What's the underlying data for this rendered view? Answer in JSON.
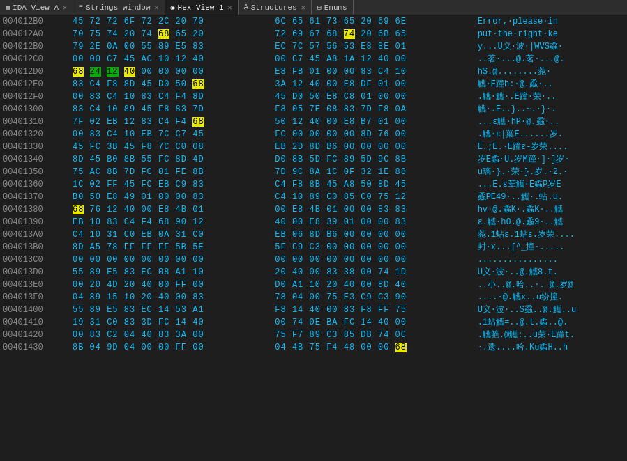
{
  "tabs": [
    {
      "id": "ida-view",
      "icon": "▦",
      "label": "IDA View-A",
      "active": false
    },
    {
      "id": "strings",
      "icon": "≡",
      "label": "Strings window",
      "active": false
    },
    {
      "id": "hex-view",
      "icon": "◉",
      "label": "Hex View-1",
      "active": true
    },
    {
      "id": "structures",
      "icon": "A",
      "label": "Structures",
      "active": false
    },
    {
      "id": "enums",
      "icon": "⊞",
      "label": "Enums",
      "active": false
    }
  ],
  "rows": [
    {
      "addr": "004012B0",
      "bytes1": [
        "45",
        "72",
        "72",
        "6F",
        "72",
        "2C",
        "20",
        "70"
      ],
      "bytes2": [
        "6C",
        "65",
        "61",
        "73",
        "65",
        "20",
        "69",
        "6E"
      ],
      "ascii": "Error,·please·in",
      "highlights": []
    },
    {
      "addr": "004012A0",
      "bytes1": [
        "70",
        "75",
        "74",
        "20",
        "74",
        "68",
        "65",
        "20"
      ],
      "bytes2": [
        "72",
        "69",
        "67",
        "68",
        "74",
        "20",
        "6B",
        "65"
      ],
      "ascii": "put·the·right·ke",
      "highlights": [
        {
          "col": 5,
          "type": "yellow"
        },
        {
          "col": 12,
          "type": "yellow"
        }
      ]
    },
    {
      "addr": "004012B0",
      "bytes1": [
        "79",
        "2E",
        "0A",
        "00",
        "55",
        "89",
        "E5",
        "83"
      ],
      "bytes2": [
        "EC",
        "7C",
        "57",
        "56",
        "53",
        "E8",
        "8E",
        "01"
      ],
      "ascii": "y...U义·波·|WVS蟊·",
      "highlights": []
    },
    {
      "addr": "004012C0",
      "bytes1": [
        "00",
        "00",
        "C7",
        "45",
        "AC",
        "10",
        "12",
        "40"
      ],
      "bytes2": [
        "00",
        "C7",
        "45",
        "A8",
        "1A",
        "12",
        "40",
        "00"
      ],
      "ascii": "..茗·...@.茗·...@.",
      "highlights": []
    },
    {
      "addr": "004012D0",
      "bytes1": [
        "68",
        "24",
        "12",
        "40",
        "00",
        "00",
        "00",
        "00"
      ],
      "bytes2": [
        "E8",
        "FB",
        "01",
        "00",
        "00",
        "83",
        "C4",
        "10"
      ],
      "ascii": "h$.@........菀·",
      "highlights": [
        {
          "col": 0,
          "type": "yellow"
        },
        {
          "col": 1,
          "type": "green"
        },
        {
          "col": 2,
          "type": "green"
        },
        {
          "col": 3,
          "type": "yellow"
        }
      ]
    },
    {
      "addr": "004012E0",
      "bytes1": [
        "83",
        "C4",
        "F8",
        "8D",
        "45",
        "D0",
        "50",
        "68"
      ],
      "bytes2": [
        "3A",
        "12",
        "40",
        "00",
        "E8",
        "DF",
        "01",
        "00"
      ],
      "ascii": "觿·E蹱h:·@.蟊·..",
      "highlights": [
        {
          "col": 7,
          "type": "yellow"
        }
      ]
    },
    {
      "addr": "004012F0",
      "bytes1": [
        "00",
        "83",
        "C4",
        "10",
        "83",
        "C4",
        "F4",
        "8D"
      ],
      "bytes2": [
        "45",
        "D0",
        "50",
        "E8",
        "C8",
        "01",
        "00",
        "00"
      ],
      "ascii": ".觿·觿·.E蹱·荣·..",
      "highlights": []
    },
    {
      "addr": "00401300",
      "bytes1": [
        "83",
        "C4",
        "10",
        "89",
        "45",
        "F8",
        "83",
        "7D"
      ],
      "bytes2": [
        "F8",
        "05",
        "7E",
        "08",
        "83",
        "7D",
        "F8",
        "0A"
      ],
      "ascii": "觿·.E..}..~.·}·.",
      "highlights": []
    },
    {
      "addr": "00401310",
      "bytes1": [
        "7F",
        "02",
        "EB",
        "12",
        "83",
        "C4",
        "F4",
        "68"
      ],
      "bytes2": [
        "50",
        "12",
        "40",
        "00",
        "E8",
        "B7",
        "01",
        "00"
      ],
      "ascii": "...ε觿·hP·@.蟊·..",
      "highlights": [
        {
          "col": 7,
          "type": "yellow"
        }
      ]
    },
    {
      "addr": "00401320",
      "bytes1": [
        "00",
        "83",
        "C4",
        "10",
        "EB",
        "7C",
        "C7",
        "45"
      ],
      "bytes2": [
        "FC",
        "00",
        "00",
        "00",
        "00",
        "8D",
        "76",
        "00"
      ],
      "ascii": ".觿·ε|罺E......岁.",
      "highlights": []
    },
    {
      "addr": "00401330",
      "bytes1": [
        "45",
        "FC",
        "3B",
        "45",
        "F8",
        "7C",
        "C0",
        "08"
      ],
      "bytes2": [
        "EB",
        "2D",
        "8D",
        "B6",
        "00",
        "00",
        "00",
        "00"
      ],
      "ascii": "E.;E.·E蹱ε-岁荣....",
      "highlights": []
    },
    {
      "addr": "00401340",
      "bytes1": [
        "8D",
        "45",
        "B0",
        "8B",
        "55",
        "FC",
        "8D",
        "4D"
      ],
      "bytes2": [
        "D0",
        "8B",
        "5D",
        "FC",
        "89",
        "5D",
        "9C",
        "8B"
      ],
      "ascii": "岁E蟊·U.岁M蹱·]·]岁·",
      "highlights": []
    },
    {
      "addr": "00401350",
      "bytes1": [
        "75",
        "AC",
        "8B",
        "7D",
        "FC",
        "01",
        "FE",
        "8B"
      ],
      "bytes2": [
        "7D",
        "9C",
        "8A",
        "1C",
        "0F",
        "32",
        "1E",
        "88"
      ],
      "ascii": "u璃·}.·荣·}.岁.·2.·",
      "highlights": []
    },
    {
      "addr": "00401360",
      "bytes1": [
        "1C",
        "02",
        "FF",
        "45",
        "FC",
        "EB",
        "C9",
        "83"
      ],
      "bytes2": [
        "C4",
        "F8",
        "8B",
        "45",
        "A8",
        "50",
        "8D",
        "45"
      ],
      "ascii": "...E.ε荤觿·E蟊P岁E",
      "highlights": []
    },
    {
      "addr": "00401370",
      "bytes1": [
        "B0",
        "50",
        "E8",
        "49",
        "01",
        "00",
        "00",
        "83"
      ],
      "bytes2": [
        "C4",
        "10",
        "89",
        "C0",
        "85",
        "C0",
        "75",
        "12"
      ],
      "ascii": "蟊PE49·..觿·.蛅.u.",
      "highlights": []
    },
    {
      "addr": "00401380",
      "bytes1": [
        "68",
        "76",
        "12",
        "40",
        "00",
        "E8",
        "4B",
        "01"
      ],
      "bytes2": [
        "00",
        "E8",
        "4B",
        "01",
        "00",
        "00",
        "83",
        "83"
      ],
      "ascii": "hv·@.蟊K·.蟊K·..觿",
      "highlights": [
        {
          "col": 0,
          "type": "yellow"
        }
      ]
    },
    {
      "addr": "00401390",
      "bytes1": [
        "EB",
        "10",
        "83",
        "C4",
        "F4",
        "68",
        "90",
        "12"
      ],
      "bytes2": [
        "40",
        "00",
        "E8",
        "39",
        "01",
        "00",
        "00",
        "83"
      ],
      "ascii": "ε.觿·hθ.@.蟊9·..觿",
      "highlights": []
    },
    {
      "addr": "004013A0",
      "bytes1": [
        "C4",
        "10",
        "31",
        "C0",
        "EB",
        "0A",
        "31",
        "C0"
      ],
      "bytes2": [
        "EB",
        "06",
        "8D",
        "B6",
        "00",
        "00",
        "00",
        "00"
      ],
      "ascii": "菀.1蛅ε.1蛅ε.岁荣....",
      "highlights": []
    },
    {
      "addr": "004013B0",
      "bytes1": [
        "8D",
        "A5",
        "78",
        "FF",
        "FF",
        "FF",
        "5B",
        "5E"
      ],
      "bytes2": [
        "5F",
        "C9",
        "C3",
        "00",
        "00",
        "00",
        "00",
        "00"
      ],
      "ascii": "封·x...[^_撞·.....",
      "highlights": []
    },
    {
      "addr": "004013C0",
      "bytes1": [
        "00",
        "00",
        "00",
        "00",
        "00",
        "00",
        "00",
        "00"
      ],
      "bytes2": [
        "00",
        "00",
        "00",
        "00",
        "00",
        "00",
        "00",
        "00"
      ],
      "ascii": "................",
      "highlights": []
    },
    {
      "addr": "004013D0",
      "bytes1": [
        "55",
        "89",
        "E5",
        "83",
        "EC",
        "08",
        "A1",
        "10"
      ],
      "bytes2": [
        "20",
        "40",
        "00",
        "83",
        "38",
        "00",
        "74",
        "1D"
      ],
      "ascii": "U义·波·..@.觿8.t.",
      "highlights": []
    },
    {
      "addr": "004013E0",
      "bytes1": [
        "00",
        "20",
        "4D",
        "20",
        "40",
        "00",
        "FF",
        "00"
      ],
      "bytes2": [
        "D0",
        "A1",
        "10",
        "20",
        "40",
        "00",
        "8D",
        "40"
      ],
      "ascii": "..小..@.哈..·. @.岁@",
      "highlights": []
    },
    {
      "addr": "004013F0",
      "bytes1": [
        "04",
        "89",
        "15",
        "10",
        "20",
        "40",
        "00",
        "83"
      ],
      "bytes2": [
        "78",
        "04",
        "00",
        "75",
        "E3",
        "C9",
        "C3",
        "90"
      ],
      "ascii": "....·@.觿x..u纷撞.",
      "highlights": []
    },
    {
      "addr": "00401400",
      "bytes1": [
        "55",
        "89",
        "E5",
        "83",
        "EC",
        "14",
        "53",
        "A1"
      ],
      "bytes2": [
        "F8",
        "14",
        "40",
        "00",
        "83",
        "F8",
        "FF",
        "75"
      ],
      "ascii": "U义·波·..S蟊..@.觿..u",
      "highlights": []
    },
    {
      "addr": "00401410",
      "bytes1": [
        "19",
        "31",
        "C0",
        "83",
        "3D",
        "FC",
        "14",
        "40"
      ],
      "bytes2": [
        "00",
        "74",
        "0E",
        "BA",
        "FC",
        "14",
        "40",
        "00"
      ],
      "ascii": ".1蛅觿=..@.t.蟊..@.",
      "highlights": []
    },
    {
      "addr": "00401420",
      "bytes1": [
        "00",
        "83",
        "C2",
        "04",
        "40",
        "83",
        "3A",
        "00"
      ],
      "bytes2": [
        "75",
        "F7",
        "89",
        "C3",
        "85",
        "DB",
        "74",
        "0C"
      ],
      "ascii": ".觿筢.@觿:..u荣·E蹱t.",
      "highlights": []
    },
    {
      "addr": "00401430",
      "bytes1": [
        "8B",
        "04",
        "9D",
        "04",
        "00",
        "00",
        "FF",
        "00"
      ],
      "bytes2": [
        "04",
        "4B",
        "75",
        "F4",
        "48",
        "00",
        "00",
        "68"
      ],
      "ascii": "·.遗....哈.Ku蟊H..h",
      "highlights": [
        {
          "col": 15,
          "type": "yellow"
        }
      ]
    }
  ]
}
